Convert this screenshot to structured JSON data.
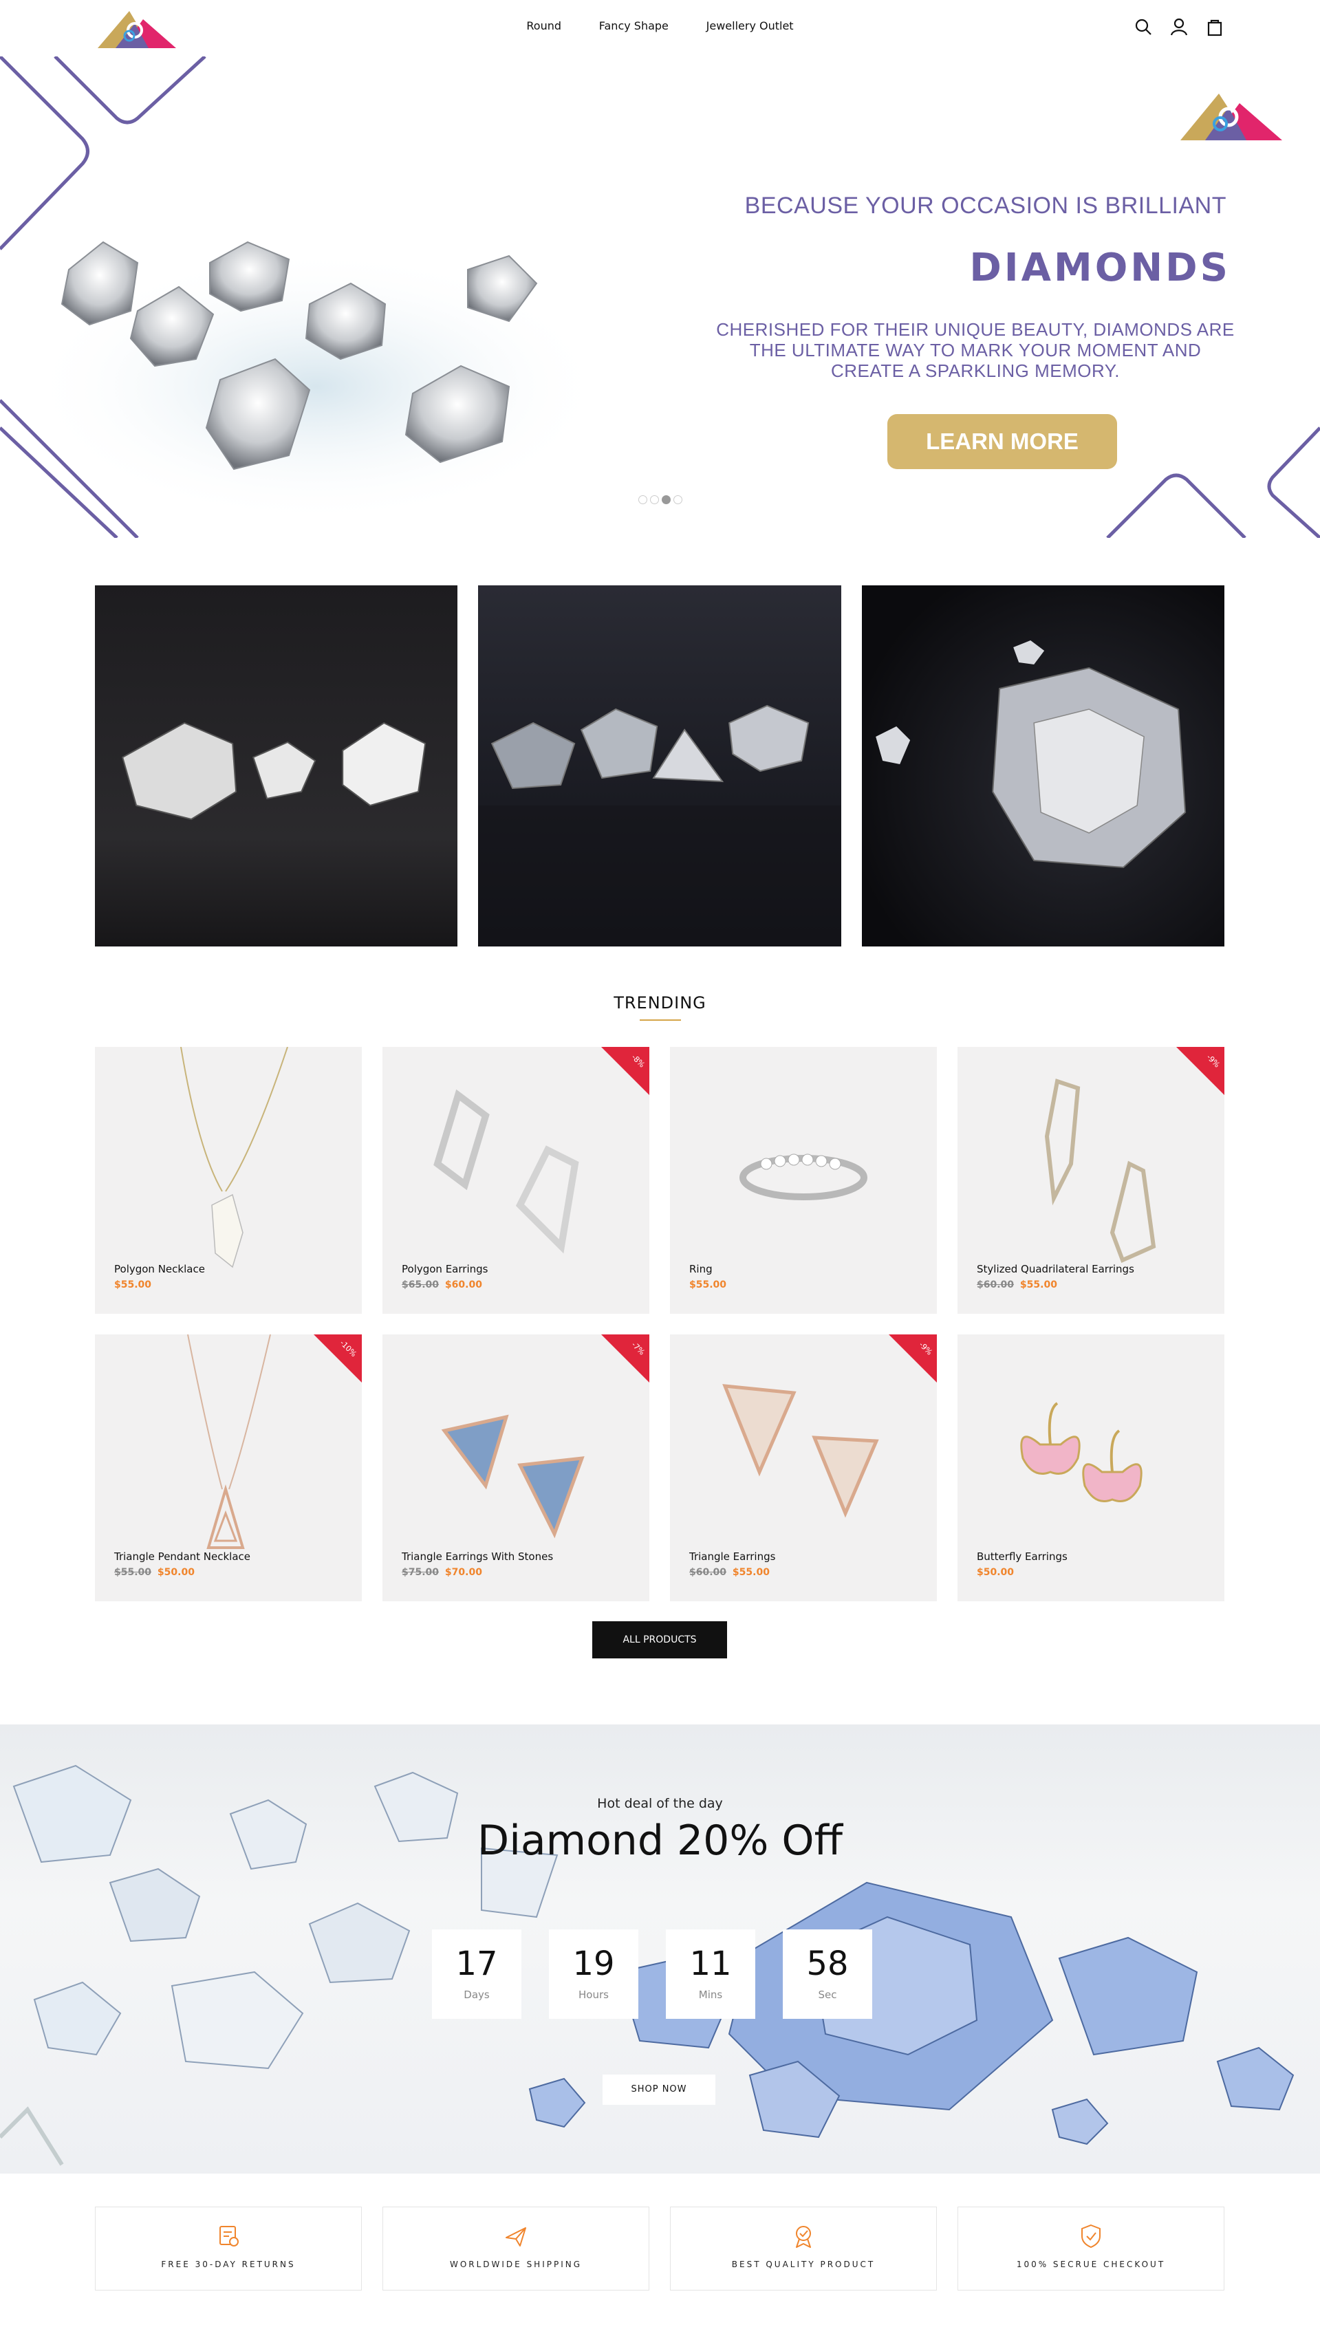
{
  "header": {
    "nav": [
      {
        "label": "Round"
      },
      {
        "label": "Fancy Shape"
      },
      {
        "label": "Jewellery Outlet"
      }
    ],
    "icons": [
      "search-icon",
      "user-icon",
      "bag-icon"
    ]
  },
  "hero": {
    "subtitle": "BECAUSE YOUR OCCASION IS BRILLIANT",
    "title": "DIAMONDS",
    "description": "CHERISHED FOR THEIR UNIQUE BEAUTY, DIAMONDS ARE THE ULTIMATE WAY TO MARK YOUR MOMENT AND CREATE A SPARKLING MEMORY.",
    "button": "LEARN MORE",
    "slides": 4,
    "active_slide": 3,
    "accent": "#6b5fa4",
    "button_color": "#d5b76f"
  },
  "trending": {
    "title": "TRENDING",
    "products": [
      {
        "name": "Polygon Necklace",
        "old_price": "",
        "price": "$55.00",
        "badge": ""
      },
      {
        "name": "Polygon Earrings",
        "old_price": "$65.00",
        "price": "$60.00",
        "badge": "-8%"
      },
      {
        "name": "Ring",
        "old_price": "",
        "price": "$55.00",
        "badge": ""
      },
      {
        "name": "Stylized Quadrilateral Earrings",
        "old_price": "$60.00",
        "price": "$55.00",
        "badge": "-9%"
      },
      {
        "name": "Triangle Pendant Necklace",
        "old_price": "$55.00",
        "price": "$50.00",
        "badge": "-10%"
      },
      {
        "name": "Triangle Earrings With Stones",
        "old_price": "$75.00",
        "price": "$70.00",
        "badge": "-7%"
      },
      {
        "name": "Triangle Earrings",
        "old_price": "$60.00",
        "price": "$55.00",
        "badge": "-9%"
      },
      {
        "name": "Butterfly Earrings",
        "old_price": "",
        "price": "$50.00",
        "badge": ""
      }
    ],
    "all_button": "ALL PRODUCTS",
    "sale_color": "#e0253b",
    "price_color": "#f0852d"
  },
  "deal": {
    "subtitle": "Hot deal of the day",
    "title": "Diamond 20% Off",
    "countdown": [
      {
        "value": "17",
        "label": "Days"
      },
      {
        "value": "19",
        "label": "Hours"
      },
      {
        "value": "11",
        "label": "Mins"
      },
      {
        "value": "58",
        "label": "Sec"
      }
    ],
    "button": "SHOP NOW"
  },
  "features": [
    {
      "label": "FREE 30-DAY RETURNS",
      "icon": "returns-icon"
    },
    {
      "label": "WORLDWIDE SHIPPING",
      "icon": "plane-icon"
    },
    {
      "label": "BEST QUALITY PRODUCT",
      "icon": "award-icon"
    },
    {
      "label": "100% SECRUE CHECKOUT",
      "icon": "shield-icon"
    }
  ]
}
